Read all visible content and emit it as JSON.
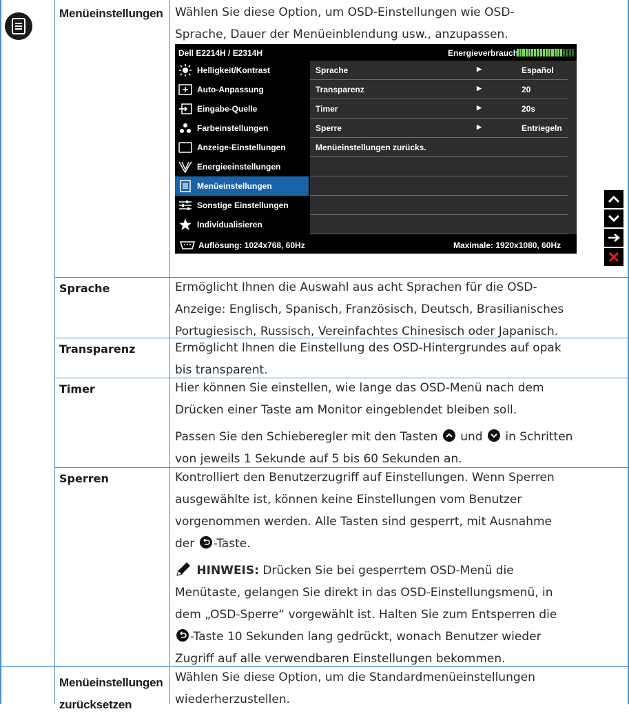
{
  "sections": {
    "menu_settings": {
      "label": "Menüeinstellungen",
      "desc": [
        "Wählen Sie diese Option, um OSD-Einstellungen wie OSD-",
        "Sprache, Dauer der Menüeinblendung usw., anzupassen."
      ]
    },
    "language": {
      "label": "Sprache",
      "desc": [
        "Ermöglicht Ihnen die Auswahl aus acht Sprachen für die OSD-",
        "Anzeige: Englisch, Spanisch, Französisch, Deutsch, Brasilianisches",
        "Portugiesisch, Russisch, Vereinfachtes Chinesisch oder Japanisch."
      ]
    },
    "transparency": {
      "label": "Transparenz",
      "desc": [
        "Ermöglicht Ihnen die Einstellung des OSD-Hintergrundes auf opak",
        "bis transparent."
      ]
    },
    "timer": {
      "label": "Timer",
      "desc": [
        "Hier können Sie einstellen, wie lange das OSD-Menü nach dem",
        "Drücken einer Taste am Monitor eingeblendet bleiben soll."
      ],
      "desc2_a": "Passen Sie den Schieberegler mit den Tasten",
      "desc2_b": "und",
      "desc2_c": "in Schritten",
      "desc2_d": "von jeweils 1 Sekunde auf 5 bis 60 Sekunden an."
    },
    "lock": {
      "label": "Sperren",
      "desc": [
        "Kontrolliert den Benutzerzugriff auf Einstellungen. Wenn Sperren",
        "ausgewählte ist, können keine Einstellungen vom Benutzer",
        "vorgenommen werden. Alle Tasten sind gesperrt, mit Ausnahme"
      ],
      "desc_last_a": "der",
      "desc_last_b": "-Taste.",
      "note_label": "HINWEIS:",
      "note_first": "Drücken Sie bei gesperrtem OSD-Menü die",
      "note_lines": [
        "Menütaste, gelangen Sie direkt in das OSD-Einstellungsmenü, in",
        "dem „OSD-Sperre“ vorgewählt ist. Halten Sie zum Entsperren die"
      ],
      "note_btn_line": "-Taste 10 Sekunden lang gedrückt, wonach Benutzer wieder",
      "note_last": "Zugriff auf alle verwendbaren Einstellungen bekommen."
    },
    "reset": {
      "label_1": "Menüeinstellungen",
      "label_2": "zurücksetzen",
      "desc": [
        "Wählen Sie diese Option, um die Standardmenüeinstellungen",
        "wiederherzustellen."
      ]
    }
  },
  "osd": {
    "model": "Dell E2214H / E2314H",
    "energy_label": "Energieverbrauch",
    "energy_level": 0.8,
    "menu": [
      {
        "label": "Helligkeit/Kontrast",
        "icon": "brightness-icon"
      },
      {
        "label": "Auto-Anpassung",
        "icon": "auto-adjust-icon"
      },
      {
        "label": "Eingabe-Quelle",
        "icon": "input-source-icon"
      },
      {
        "label": "Farbeinstellungen",
        "icon": "color-icon"
      },
      {
        "label": "Anzeige-Einstellungen",
        "icon": "display-icon"
      },
      {
        "label": "Energieeinstellungen",
        "icon": "energy-icon"
      },
      {
        "label": "Menüeinstellungen",
        "icon": "menu-icon"
      },
      {
        "label": "Sonstige Einstellungen",
        "icon": "other-settings-icon"
      },
      {
        "label": "Individualisieren",
        "icon": "star-icon"
      }
    ],
    "active_index": 6,
    "rows": [
      {
        "name": "Sprache",
        "arrow": "▶",
        "value": "Español"
      },
      {
        "name": "Transparenz",
        "arrow": "▶",
        "value": "20"
      },
      {
        "name": "Timer",
        "arrow": "▶",
        "value": "20s"
      },
      {
        "name": "Sperre",
        "arrow": "▶",
        "value": "Entriegeln"
      },
      {
        "name": "Menüeinstellungen zurücks.",
        "arrow": "",
        "value": ""
      },
      {
        "name": "",
        "arrow": "",
        "value": ""
      },
      {
        "name": "",
        "arrow": "",
        "value": ""
      },
      {
        "name": "",
        "arrow": "",
        "value": ""
      },
      {
        "name": "",
        "arrow": "",
        "value": ""
      }
    ],
    "resolution": "Auflösung: 1024x768,   60Hz",
    "max_resolution": "Maximale: 1920x1080,   60Hz"
  },
  "colors": {
    "grid": "#4a90c9",
    "osd_active": "#1a63a8",
    "energy_bar": "#7bd85c",
    "close_x": "#e0261e"
  }
}
